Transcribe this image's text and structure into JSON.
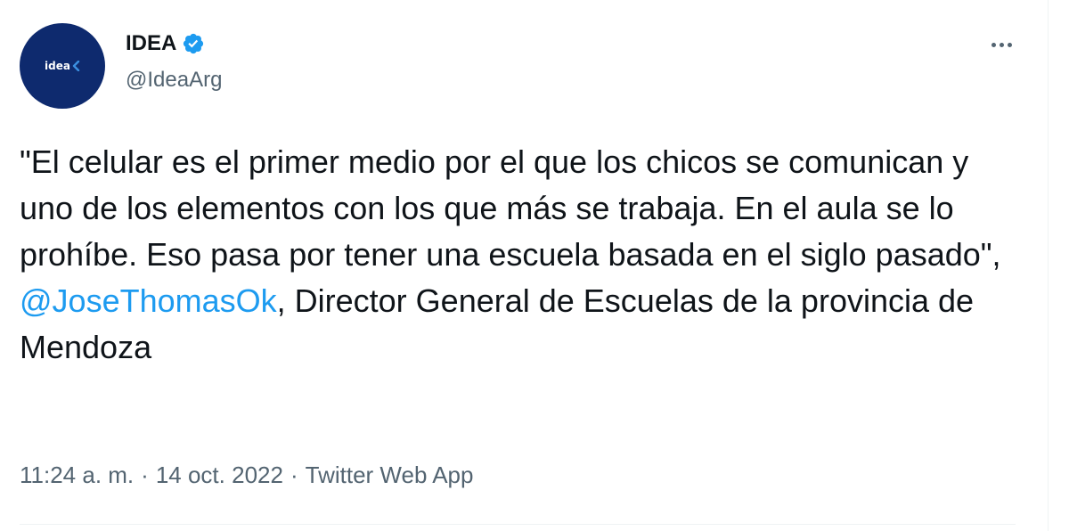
{
  "accent_color": "#1d9bf0",
  "author": {
    "avatar_text": "IDEA",
    "avatar_icon": "chevron-left-icon",
    "avatar_color": "#0e2a6e",
    "display_name": "IDEA",
    "verified_icon": "verified-badge-icon",
    "handle": "@IdeaArg"
  },
  "more_icon": "more-horizontal-icon",
  "tweet": {
    "text_before_mention": "\"El celular es el primer medio por el que los chicos se comunican y uno de los elementos con los que más se trabaja. En el aula se lo prohíbe. Eso pasa por tener una escuela basada en el siglo pasado\",\n",
    "mention": "@JoseThomasOk",
    "text_after_mention": ", Director General de Escuelas de la provincia de Mendoza"
  },
  "meta": {
    "time": "11:24 a. m.",
    "separator": "·",
    "date": "14 oct. 2022",
    "source": "Twitter Web App"
  }
}
